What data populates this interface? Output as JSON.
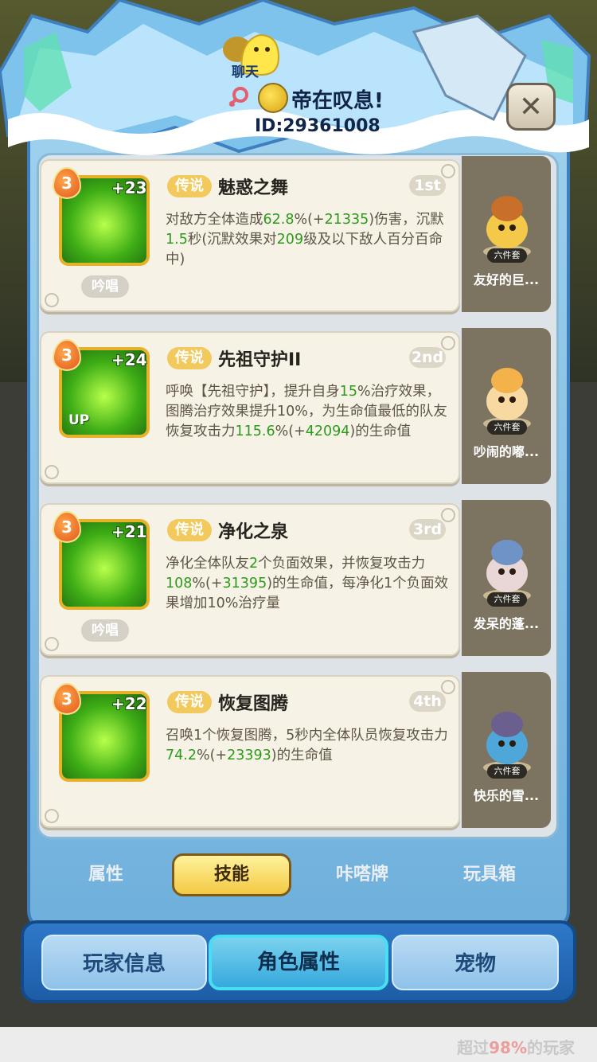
{
  "header": {
    "chat_label": "聊天",
    "player_name": "帝在叹息!",
    "player_id": "ID:29361008",
    "close_label": "✕"
  },
  "skills": [
    {
      "level": "3",
      "plus": "+23",
      "tag": "传说",
      "name": "魅惑之舞",
      "rank": "1st",
      "chant": "吟唱",
      "desc": [
        "对敌方全体造成",
        "62.8",
        "%(+",
        "21335",
        ")伤害，沉默",
        "1.5",
        "秒(沉默效果对",
        "209",
        "级及以下敌人百分百命中)"
      ]
    },
    {
      "level": "3",
      "plus": "+24",
      "tag": "传说",
      "name": "先祖守护II",
      "rank": "2nd",
      "up": "UP",
      "desc": [
        "呼唤【先祖守护】，提升自身",
        "15",
        "%治疗效果，图腾治疗效果提升10%，为生命值最低的队友恢复攻击力",
        "115.6",
        "%(+",
        "42094",
        ")的生命值"
      ]
    },
    {
      "level": "3",
      "plus": "+21",
      "tag": "传说",
      "name": "净化之泉",
      "rank": "3rd",
      "chant": "吟唱",
      "desc": [
        "净化全体队友",
        "2",
        "个负面效果，并恢复攻击力",
        "108",
        "%(+",
        "31395",
        ")的生命值，每净化1个负面效果增加10%治疗量"
      ]
    },
    {
      "level": "3",
      "plus": "+22",
      "tag": "传说",
      "name": "恢复图腾",
      "rank": "4th",
      "desc": [
        "召唤1个恢复图腾，5秒内全体队员恢复攻击力",
        "74.2",
        "%(+",
        "23393",
        ")的生命值"
      ]
    }
  ],
  "pets": [
    {
      "badge": "六件套",
      "name": "友好的巨..."
    },
    {
      "badge": "六件套",
      "name": "吵闹的嘟..."
    },
    {
      "badge": "六件套",
      "name": "发呆的蓬..."
    },
    {
      "badge": "六件套",
      "name": "快乐的雪..."
    }
  ],
  "tabs": [
    "属性",
    "技能",
    "咔嗒牌",
    "玩具箱"
  ],
  "bottom_nav": [
    "玩家信息",
    "角色属性",
    "宠物"
  ],
  "footer": {
    "rank_prefix": "超过",
    "rank_value": "98%",
    "rank_suffix": "的玩家"
  },
  "colors": {
    "highlight_green": "#2c9b1c",
    "tag_gold": "#f1c95d",
    "active_tab": "#f3c943"
  }
}
